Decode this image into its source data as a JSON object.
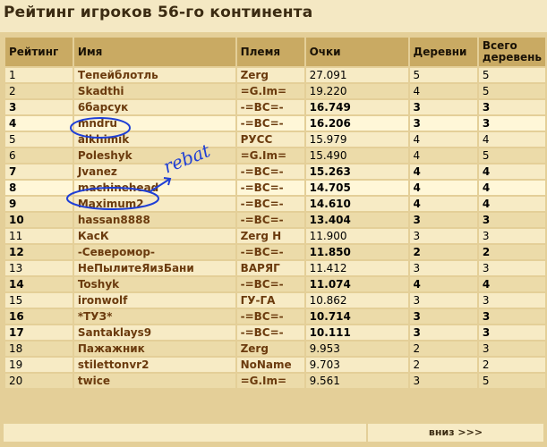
{
  "title": "Рейтинг игроков 56-го континента",
  "headers": {
    "rank": "Рейтинг",
    "name": "Имя",
    "tribe": "Племя",
    "points": "Очки",
    "villages": "Деревни",
    "total_villages": "Всего деревень"
  },
  "rows": [
    {
      "rank": "1",
      "name": "Тепейблотль",
      "tribe": "Zerg",
      "points": "27.091",
      "villages": "5",
      "total": "5"
    },
    {
      "rank": "2",
      "name": "Skadthi",
      "tribe": "=G.Im=",
      "points": "19.220",
      "villages": "4",
      "total": "5"
    },
    {
      "rank": "3",
      "name": "6барсук",
      "tribe": "-=BC=-",
      "points": "16.749",
      "villages": "3",
      "total": "3"
    },
    {
      "rank": "4",
      "name": "mndru",
      "tribe": "-=BC=-",
      "points": "16.206",
      "villages": "3",
      "total": "3"
    },
    {
      "rank": "5",
      "name": "alkhimik",
      "tribe": "РУСС",
      "points": "15.979",
      "villages": "4",
      "total": "4"
    },
    {
      "rank": "6",
      "name": "Poleshyk",
      "tribe": "=G.Im=",
      "points": "15.490",
      "villages": "4",
      "total": "5"
    },
    {
      "rank": "7",
      "name": "Jvanez",
      "tribe": "-=BC=-",
      "points": "15.263",
      "villages": "4",
      "total": "4"
    },
    {
      "rank": "8",
      "name": "machinehead",
      "tribe": "-=BC=-",
      "points": "14.705",
      "villages": "4",
      "total": "4"
    },
    {
      "rank": "9",
      "name": "Maximum2",
      "tribe": "-=BC=-",
      "points": "14.610",
      "villages": "4",
      "total": "4"
    },
    {
      "rank": "10",
      "name": "hassan8888",
      "tribe": "-=BC=-",
      "points": "13.404",
      "villages": "3",
      "total": "3"
    },
    {
      "rank": "11",
      "name": "КасК",
      "tribe": "Zerg H",
      "points": "11.900",
      "villages": "3",
      "total": "3"
    },
    {
      "rank": "12",
      "name": "-Северомор-",
      "tribe": "-=BC=-",
      "points": "11.850",
      "villages": "2",
      "total": "2"
    },
    {
      "rank": "13",
      "name": "НеПылитеЯизБани",
      "tribe": "ВАРЯГ",
      "points": "11.412",
      "villages": "3",
      "total": "3"
    },
    {
      "rank": "14",
      "name": "Toshyk",
      "tribe": "-=BC=-",
      "points": "11.074",
      "villages": "4",
      "total": "4"
    },
    {
      "rank": "15",
      "name": "ironwolf",
      "tribe": "ГУ-ГА",
      "points": "10.862",
      "villages": "3",
      "total": "3"
    },
    {
      "rank": "16",
      "name": "*ТУЗ*",
      "tribe": "-=BC=-",
      "points": "10.714",
      "villages": "3",
      "total": "3"
    },
    {
      "rank": "17",
      "name": "Santaklays9",
      "tribe": "-=BC=-",
      "points": "10.111",
      "villages": "3",
      "total": "3"
    },
    {
      "rank": "18",
      "name": "Пажажник",
      "tribe": "Zerg",
      "points": "9.953",
      "villages": "2",
      "total": "3"
    },
    {
      "rank": "19",
      "name": "stilettonvr2",
      "tribe": "NoName",
      "points": "9.703",
      "villages": "2",
      "total": "2"
    },
    {
      "rank": "20",
      "name": "twice",
      "tribe": "=G.Im=",
      "points": "9.561",
      "villages": "3",
      "total": "5"
    }
  ],
  "bold_rows": [
    "3",
    "4",
    "7",
    "8",
    "9",
    "10",
    "12",
    "14",
    "16",
    "17"
  ],
  "highlight_rows": [
    "4",
    "8"
  ],
  "footer": {
    "next_label": "вниз >>>"
  },
  "annotation": {
    "scribble_text": "rebat"
  },
  "colors": {
    "header_bg": "#c9aa63",
    "row_bg": "#f7ebc5",
    "row_alt_bg": "#ecdba9",
    "ink": "#1f3fd6",
    "link": "#6b3b0e"
  }
}
